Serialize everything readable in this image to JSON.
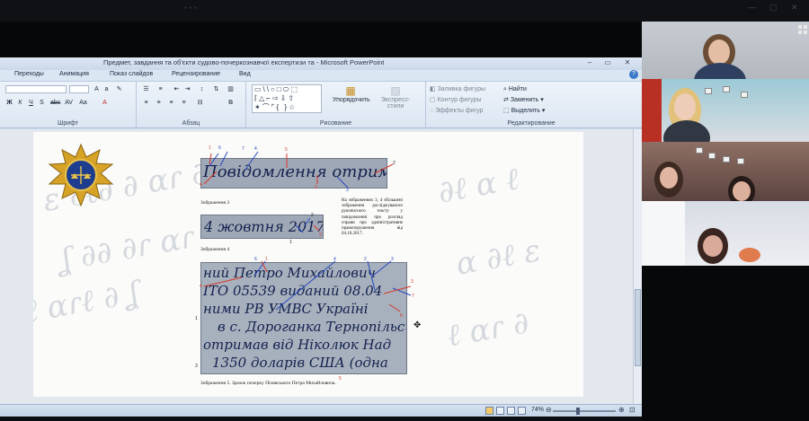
{
  "ppt": {
    "title": "Предмет, завдання та об'єкти судово-почеркознавчої експертизи та  -  Microsoft PowerPoint",
    "tabs": [
      "Переходы",
      "Анимация",
      "Показ слайдов",
      "Рецензирование",
      "Вид"
    ],
    "ribbon": {
      "font_group": "Шрифт",
      "paragraph_group": "Абзац",
      "drawing_group": "Рисование",
      "editing_group": "Редактирование",
      "arrange": "Упорядочить",
      "quick_styles": "Экспресс-стили",
      "shape_fill": "Заливка фигуры",
      "shape_outline": "Контур фигуры",
      "shape_effects": "Эффекты фигур",
      "find": "Найти",
      "replace": "Заменить",
      "select": "Выделить"
    },
    "slide": {
      "captions": [
        "Зображення 3",
        "Зображення 4",
        "Зображення 5. Зразок почерку Пілявського Петра Михайловича."
      ],
      "note": "На зображеннях 3, 4 збільшені зображення досліджуваного рукописного тексту у повідомленні про розгляд справи про адміністративне правопорушення від 04.10.2017.",
      "handwriting_1": "Повідомлення отримав",
      "handwriting_2": "4 жовтня 2017",
      "handwriting_3": [
        "ний Петро Михайлович",
        "ІТО 05539 виданий 08.04",
        "ними РВ УМВС Україні",
        "в с. Дороганка Тернопільськ",
        "отримав від Ніколюк Над",
        "1350 доларів США (одна"
      ],
      "markers_red": [
        "1",
        "4",
        "5",
        "3",
        "2",
        "1",
        "4",
        "5",
        "3",
        "7",
        "6"
      ],
      "markers_blue": [
        "6",
        "7",
        "4",
        "3",
        "5",
        "1",
        "2",
        "6",
        "4",
        "3",
        "2"
      ],
      "markers_black": [
        "2",
        "1",
        "3",
        "5"
      ]
    },
    "status": {
      "zoom": "74%"
    }
  },
  "ui_colors": {
    "accent": "#3b78c8",
    "annotation_red": "#d8382c",
    "annotation_blue": "#2a48c2"
  }
}
